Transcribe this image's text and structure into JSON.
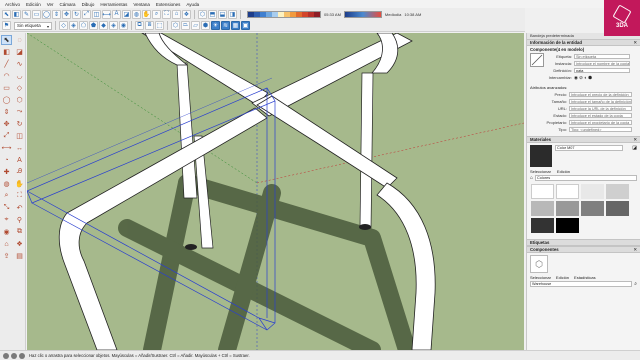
{
  "menu": [
    "Archivo",
    "Edición",
    "Ver",
    "Cámara",
    "Dibujo",
    "Herramientas",
    "Ventana",
    "Extensiones",
    "Ayuda"
  ],
  "toolbar": {
    "tag_dropdown": "Sin etiqueta",
    "time_label": "05:33 AM",
    "time_label2": "Mediodía",
    "time_label3": "10:38 AM"
  },
  "viewport": {
    "background": "#a6b98c",
    "shadow_color": "#4a5a3b",
    "pipe_color": "#ffffff",
    "bbox_color": "#2a3fcf"
  },
  "status": {
    "text": "Haz clic o arrastra para seleccionar objetos. Mayúsculas = Añadir/Sustraer. Ctrl = Añadir. Mayúsculas + Ctrl = Sustraer."
  },
  "tray": {
    "title": "Bandeja predeterminada",
    "entity_section": "Información de la entidad",
    "component_name": "Componente(4 en modelo)",
    "fields": {
      "etiqueta_label": "Etiqueta:",
      "etiqueta_value": "Sin etiqueta",
      "instancia_label": "Instancia:",
      "instancia_placeholder": "Introduce el nombre de la copia",
      "definicion_label": "Definición:",
      "definicion_value": "pata",
      "intercambiar_label": "Intercambiar:"
    },
    "advanced_title": "Atributos avanzados:",
    "advanced": [
      {
        "label": "Precio:",
        "placeholder": "Introduce el precio de la definición"
      },
      {
        "label": "Tamaño:",
        "placeholder": "Introduce el tamaño de la definición"
      },
      {
        "label": "URL:",
        "placeholder": "Introduce la URL de la definición"
      },
      {
        "label": "Estado:",
        "placeholder": "Introduce el estado de la copia"
      },
      {
        "label": "Propietario:",
        "placeholder": "Introduce el propietario de la copia"
      },
      {
        "label": "Tipo:",
        "placeholder": "Tipo: <undefined>"
      }
    ],
    "materials_section": "Materiales",
    "material_name": "Color M07",
    "materials_tabs": [
      "Seleccionar",
      "Edición"
    ],
    "materials_dropdown": "Colores",
    "swatches": [
      "#ffffff",
      "#ffffff",
      "#e8e8e8",
      "#cfcfcf",
      "#b8b8b8",
      "#999999",
      "#7f7f7f",
      "#666666",
      "#4d4d4d",
      "#333333",
      "#1a1a1a",
      "#000000"
    ],
    "tags_section": "Etiquetas",
    "components_section": "Componentes",
    "components_tabs": [
      "Seleccionar",
      "Edición",
      "Estadísticas"
    ],
    "components_search": "Warehouse"
  },
  "badge": {
    "text": "3DA"
  }
}
